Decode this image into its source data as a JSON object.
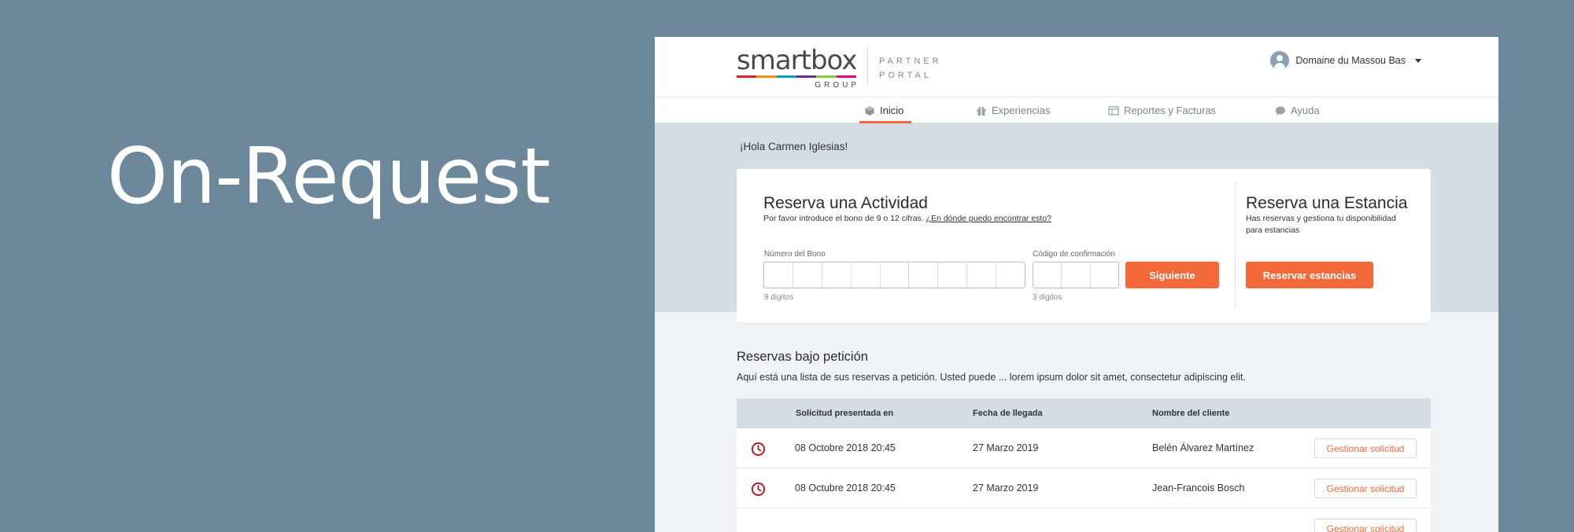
{
  "hero": {
    "title": "On-Request"
  },
  "brand": {
    "word": "smartbox",
    "group": "GROUP",
    "portal_line1": "PARTNER",
    "portal_line2": "PORTAL",
    "bar_colors": [
      "#d6232a",
      "#f39200",
      "#00a0b0",
      "#6c2e8c",
      "#8cc63f",
      "#e5007d"
    ]
  },
  "user": {
    "name": "Domaine du Massou Bas"
  },
  "nav": {
    "items": [
      {
        "label": "Inicio",
        "icon": "cube-icon",
        "active": true
      },
      {
        "label": "Experiencias",
        "icon": "gift-icon",
        "active": false
      },
      {
        "label": "Reportes y Facturas",
        "icon": "report-icon",
        "active": false
      },
      {
        "label": "Ayuda",
        "icon": "chat-icon",
        "active": false
      }
    ]
  },
  "greeting": "¡Hola Carmen Iglesias!",
  "activity": {
    "title": "Reserva una Actividad",
    "subtitle": "Por favor introduce el bono de 9 o 12 cifras.",
    "help_link": "¿En dónde puedo encontrar esto?",
    "voucher_label": "Número del Bono",
    "voucher_hint": "9 digitos",
    "voucher_digits": 9,
    "code_label": "Código de confirmación",
    "code_hint": "3 digitos",
    "code_digits": 3,
    "next_button": "Siguiente"
  },
  "stay": {
    "title": "Reserva una Estancia",
    "subtitle_line1": "Has reservas y gestiona tu disponibilidad",
    "subtitle_line2": "para estancias",
    "button": "Reservar estancias"
  },
  "requests": {
    "title": "Reservas bajo petición",
    "description": "Aquí está una lista de sus reservas a petición. Usted puede ... lorem ipsum dolor sit amet, consectetur adipiscing elit.",
    "columns": [
      "Solicitud presentada en",
      "Fecha de llegada",
      "Nombre del cliente"
    ],
    "rows": [
      {
        "submitted": "08 Octobre 2018  20:45",
        "arrival": "27 Marzo 2019",
        "client": "Belén Álvarez Martínez",
        "action": "Gestionar solicitud"
      },
      {
        "submitted": "08 Octubre 2018  20:45",
        "arrival": "27 Marzo 2019",
        "client": "Jean-Francois Bosch",
        "action": "Gestionar solicitud"
      },
      {
        "submitted": "",
        "arrival": "",
        "client": "",
        "action": "Gestionar solicitud"
      }
    ]
  },
  "colors": {
    "accent": "#f4693a",
    "clock": "#b3262d",
    "background": "#6d879b"
  }
}
